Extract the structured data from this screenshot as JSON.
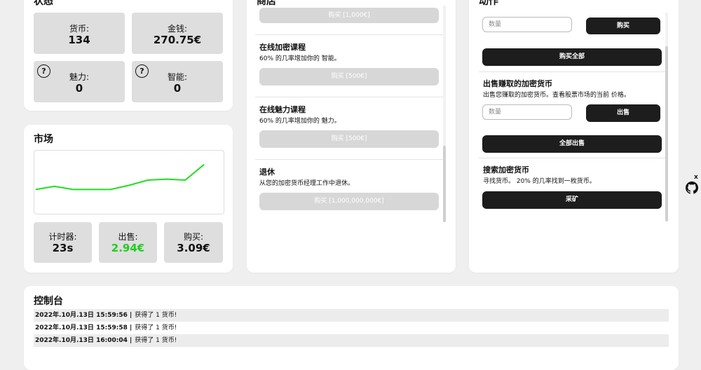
{
  "status": {
    "title": "状态",
    "coins_label": "货币:",
    "coins_value": "134",
    "money_label": "金钱:",
    "money_value": "270.75€",
    "charm_label": "魅力:",
    "charm_value": "0",
    "intel_label": "智能:",
    "intel_value": "0",
    "help_glyph": "?"
  },
  "market": {
    "title": "市场",
    "timer_label": "计时器:",
    "timer_value": "23s",
    "sell_label": "出售:",
    "sell_value": "2.94€",
    "buy_label": "购买:",
    "buy_value": "3.09€",
    "line_color": "#22dd22",
    "chart_data": {
      "type": "line",
      "title": "",
      "xlabel": "",
      "ylabel": "",
      "x": [
        1,
        2,
        3,
        4,
        5,
        6,
        7,
        8,
        9,
        10
      ],
      "values": [
        2.78,
        2.81,
        2.78,
        2.78,
        2.78,
        2.82,
        2.87,
        2.88,
        2.87,
        3.02
      ]
    }
  },
  "shop": {
    "title": "商店",
    "top_button": "购买 [1,000€]",
    "items": [
      {
        "title": "在线加密课程",
        "desc": "60% 的几率增加你的 智能。",
        "button": "购买 [500€]"
      },
      {
        "title": "在线魅力课程",
        "desc": "60% 的几率增加你的 魅力。",
        "button": "购买 [500€]"
      },
      {
        "title": "退休",
        "desc": "从您的加密货币经理工作中退休。",
        "button": "购买 [1,000,000,000€]"
      }
    ]
  },
  "actions": {
    "title": "动作",
    "qty_placeholder": "数量",
    "buy_button": "购买",
    "buy_all_button": "购买全部",
    "sell_title": "出售赚取的加密货币",
    "sell_desc": "出售您赚取的加密货币。查看股票市场的当前 价格。",
    "sell_button": "出售",
    "sell_all_button": "全部出售",
    "mine_title": "搜索加密货币",
    "mine_desc": "寻找货币。 20% 的几率找到一枚货币。",
    "mine_button": "采矿"
  },
  "console": {
    "title": "控制台",
    "logs": [
      {
        "time": "2022年.10月.13日 15:59:56 |",
        "msg": "获得了 1 货币!"
      },
      {
        "time": "2022年.10月.13日 15:59:58 |",
        "msg": "获得了 1 货币!"
      },
      {
        "time": "2022年.10月.13日 16:00:04 |",
        "msg": "获得了 1 货币!"
      }
    ]
  },
  "side": {
    "close_glyph": "x",
    "icon": "github-icon"
  }
}
